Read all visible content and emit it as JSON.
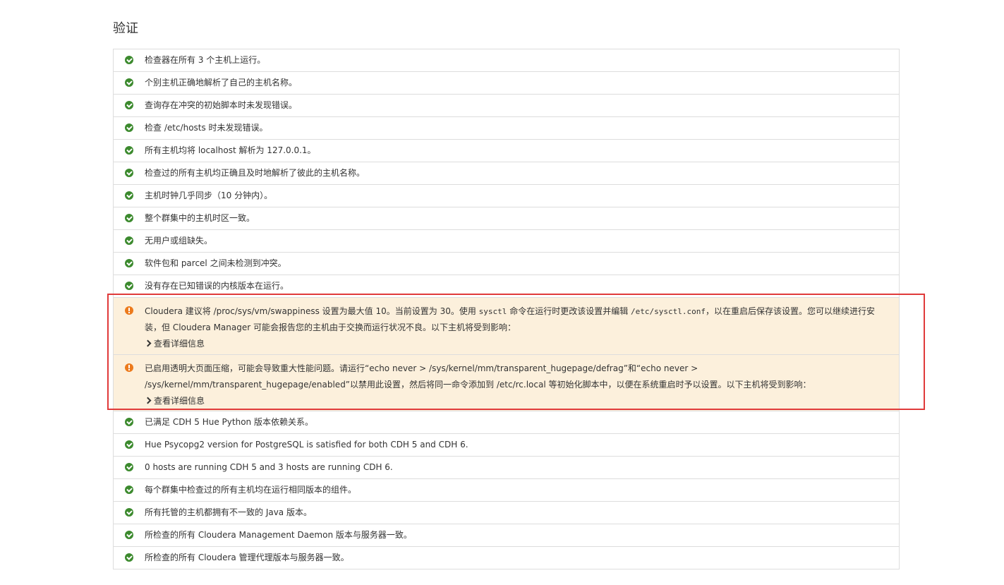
{
  "page": {
    "title": "验证"
  },
  "checks": [
    {
      "status": "ok",
      "text": "检查器在所有 3 个主机上运行。"
    },
    {
      "status": "ok",
      "text": "个别主机正确地解析了自己的主机名称。"
    },
    {
      "status": "ok",
      "text": "查询存在冲突的初始脚本时未发现错误。"
    },
    {
      "status": "ok",
      "text": "检查 /etc/hosts 时未发现错误。"
    },
    {
      "status": "ok",
      "text": "所有主机均将 localhost 解析为 127.0.0.1。"
    },
    {
      "status": "ok",
      "text": "检查过的所有主机均正确且及时地解析了彼此的主机名称。"
    },
    {
      "status": "ok",
      "text": "主机时钟几乎同步（10 分钟内）。"
    },
    {
      "status": "ok",
      "text": "整个群集中的主机时区一致。"
    },
    {
      "status": "ok",
      "text": "无用户或组缺失。"
    },
    {
      "status": "ok",
      "text": "软件包和 parcel 之间未检测到冲突。"
    },
    {
      "status": "ok",
      "text": "没有存在已知错误的内核版本在运行。"
    }
  ],
  "warnings": [
    {
      "status": "warning",
      "text_part1": "Cloudera 建议将 /proc/sys/vm/swappiness 设置为最大值 10。当前设置为 30。使用 ",
      "code1": "sysctl",
      "text_part2": " 命令在运行时更改该设置并编辑 ",
      "code2": "/etc/sysctl.conf",
      "text_part3": "，以在重启后保存该设置。您可以继续进行安装，但 Cloudera Manager 可能会报告您的主机由于交换而运行状况不良。以下主机将受到影响：",
      "details_label": "查看详细信息"
    },
    {
      "status": "warning",
      "text": "已启用透明大页面压缩，可能会导致重大性能问题。请运行“echo never > /sys/kernel/mm/transparent_hugepage/defrag”和“echo never > /sys/kernel/mm/transparent_hugepage/enabled”以禁用此设置，然后将同一命令添加到 /etc/rc.local 等初始化脚本中，以便在系统重启时予以设置。以下主机将受到影响：",
      "details_label": "查看详细信息"
    }
  ],
  "checks_after": [
    {
      "status": "ok",
      "text": "已满足 CDH 5 Hue Python 版本依赖关系。"
    },
    {
      "status": "ok",
      "text": "Hue Psycopg2 version for PostgreSQL is satisfied for both CDH 5 and CDH 6."
    },
    {
      "status": "ok",
      "text": "0 hosts are running CDH 5 and 3 hosts are running CDH 6."
    },
    {
      "status": "ok",
      "text": "每个群集中检查过的所有主机均在运行相同版本的组件。"
    },
    {
      "status": "ok",
      "text": "所有托管的主机都拥有不一致的 Java 版本。"
    },
    {
      "status": "ok",
      "text": "所检查的所有 Cloudera Management Daemon 版本与服务器一致。"
    },
    {
      "status": "ok",
      "text": "所检查的所有 Cloudera 管理代理版本与服务器一致。"
    }
  ],
  "colors": {
    "ok_icon": "#3c8a2e",
    "warning_icon": "#ec7a1c",
    "warning_background": "#fcf0dc",
    "highlight_border": "#e03a3a",
    "row_border": "#dddddd"
  },
  "icons": {
    "ok": "check-circle-icon",
    "warning": "exclamation-circle-icon",
    "details": "chevron-right-icon"
  }
}
